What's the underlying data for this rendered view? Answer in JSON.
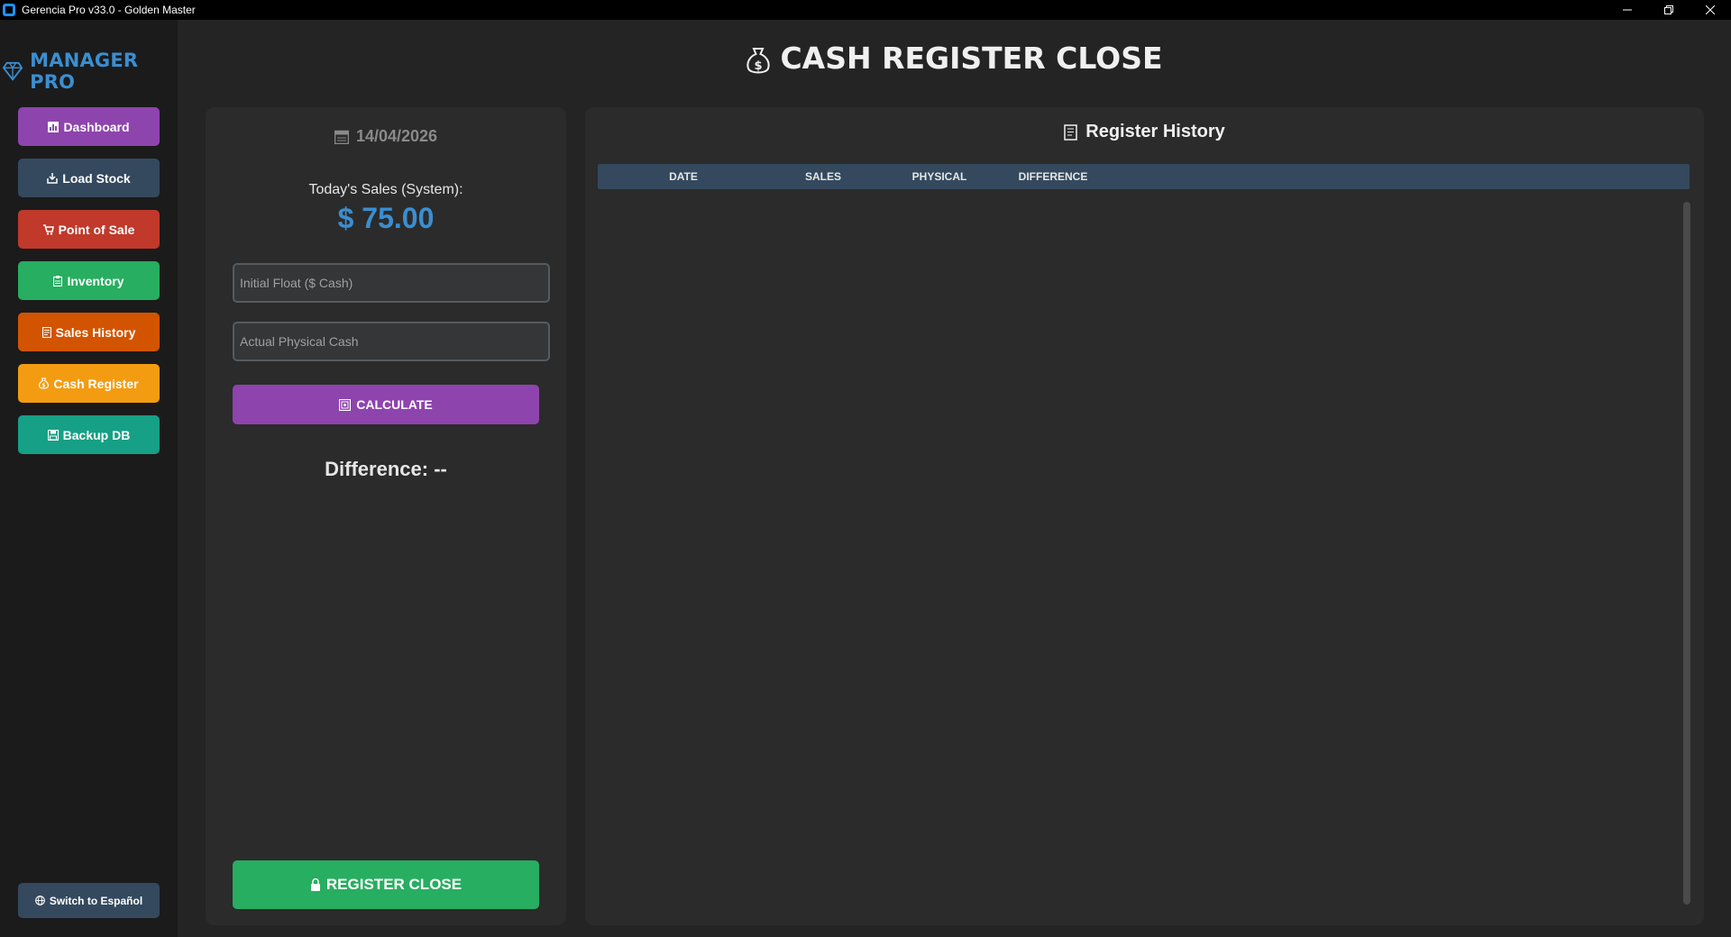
{
  "window": {
    "title": "Gerencia Pro v33.0 - Golden Master"
  },
  "sidebar": {
    "logo_text": "MANAGER PRO",
    "items": [
      {
        "label": "Dashboard",
        "color": "#8e44ad",
        "icon": "chart-icon"
      },
      {
        "label": "Load Stock",
        "color": "#34495e",
        "icon": "inbox-icon"
      },
      {
        "label": "Point of Sale",
        "color": "#c0392b",
        "icon": "cart-icon"
      },
      {
        "label": "Inventory",
        "color": "#27ae60",
        "icon": "clipboard-icon"
      },
      {
        "label": "Sales History",
        "color": "#d35400",
        "icon": "receipt-icon"
      },
      {
        "label": "Cash Register",
        "color": "#f39c12",
        "icon": "money-bag-icon"
      },
      {
        "label": "Backup DB",
        "color": "#16a085",
        "icon": "floppy-icon"
      }
    ],
    "language_button": {
      "label": "Switch to Español",
      "color": "#34495e",
      "icon": "globe-icon"
    }
  },
  "page": {
    "title": "CASH REGISTER CLOSE"
  },
  "close_panel": {
    "date": "14/04/2026",
    "sales_label": "Today's Sales (System):",
    "sales_value": "$ 75.00",
    "initial_float_placeholder": "Initial Float ($ Cash)",
    "initial_float_value": "",
    "physical_cash_placeholder": "Actual Physical Cash",
    "physical_cash_value": "",
    "calculate_label": "CALCULATE",
    "difference_label": "Difference: --",
    "register_close_label": "REGISTER CLOSE"
  },
  "history": {
    "title": "Register History",
    "columns": [
      "DATE",
      "SALES",
      "PHYSICAL",
      "DIFFERENCE"
    ],
    "rows": []
  },
  "colors": {
    "accent_blue": "#3b8ed0",
    "calculate": "#8e44ad",
    "register_close": "#27ae60",
    "table_header": "#34495e"
  }
}
